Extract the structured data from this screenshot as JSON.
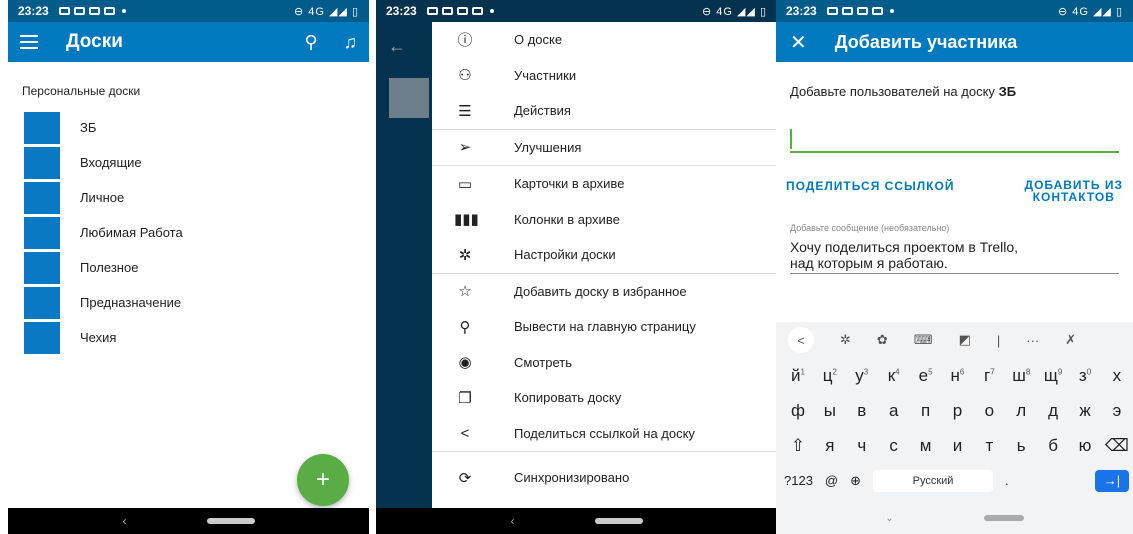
{
  "screen1": {
    "status": {
      "time": "23:23",
      "sys": "⊖ 4G ◢◢ ▯"
    },
    "appbar": {
      "title": "Доски"
    },
    "section": "Персональные доски",
    "boards": [
      "ЗБ",
      "Входящие",
      "Личное",
      "Любимая Работа",
      "Полезное",
      "Предназначение",
      "Чехия"
    ],
    "fab": "+",
    "nav": {
      "back": "‹"
    }
  },
  "screen2": {
    "status": {
      "time": "23:23",
      "sys": "⊖ 4G ◢◢ ▯"
    },
    "back": "←",
    "groups": [
      [
        {
          "icon": "ⓘ",
          "label": "О доске",
          "name": "about-board"
        },
        {
          "icon": "⚇",
          "label": "Участники",
          "name": "members"
        },
        {
          "icon": "☰",
          "label": "Действия",
          "name": "actions"
        }
      ],
      [
        {
          "icon": "➢",
          "label": "Улучшения",
          "name": "power-ups"
        }
      ],
      [
        {
          "icon": "▭",
          "label": "Карточки в архиве",
          "name": "archived-cards"
        },
        {
          "icon": "▮▮▮",
          "label": "Колонки в архиве",
          "name": "archived-lists"
        },
        {
          "icon": "✲",
          "label": "Настройки доски",
          "name": "board-settings"
        }
      ],
      [
        {
          "icon": "☆",
          "label": "Добавить доску в избранное",
          "name": "add-favorite"
        },
        {
          "icon": "⚲",
          "label": "Вывести на главную страницу",
          "name": "pin-home"
        },
        {
          "icon": "◉",
          "label": "Смотреть",
          "name": "watch"
        },
        {
          "icon": "❐",
          "label": "Копировать доску",
          "name": "copy-board"
        },
        {
          "icon": "<",
          "label": "Поделиться ссылкой на доску",
          "name": "share-link"
        }
      ],
      [
        {
          "icon": "⟳",
          "label": "Синхронизировано",
          "name": "synced"
        }
      ]
    ],
    "nav": {
      "back": "‹"
    }
  },
  "screen3": {
    "status": {
      "time": "23:23",
      "sys": "⊖ 4G ◢◢ ▯"
    },
    "appbar": {
      "close": "✕",
      "title": "Добавить участника"
    },
    "add_text": "Добавьте пользователей на доску",
    "board_name": "ЗБ",
    "field_value": "",
    "share_link": "ПОДЕЛИТЬСЯ ССЫЛКОЙ",
    "add_contacts_1": "ДОБАВИТЬ ИЗ",
    "add_contacts_2": "КОНТАКТОВ",
    "hint": "Добавьте сообщение (необязательно)",
    "message_1": "Хочу поделиться проектом в Trello,",
    "message_2": "над которым я работаю.",
    "keyboard": {
      "tools": [
        "<",
        "✲",
        "✿",
        "⌨",
        "◩",
        "|",
        "···",
        "✗"
      ],
      "row1": [
        [
          "й",
          "1"
        ],
        [
          "ц",
          "2"
        ],
        [
          "у",
          "3"
        ],
        [
          "к",
          "4"
        ],
        [
          "е",
          "5"
        ],
        [
          "н",
          "6"
        ],
        [
          "г",
          "7"
        ],
        [
          "ш",
          "8"
        ],
        [
          "щ",
          "9"
        ],
        [
          "з",
          "0"
        ],
        [
          "х",
          ""
        ]
      ],
      "row2": [
        "ф",
        "ы",
        "в",
        "а",
        "п",
        "р",
        "о",
        "л",
        "д",
        "ж",
        "э"
      ],
      "row3": [
        "⇧",
        "я",
        "ч",
        "с",
        "м",
        "и",
        "т",
        "ь",
        "б",
        "ю",
        "⌫"
      ],
      "sym": "?123",
      "at": "@",
      "globe": "⊕",
      "lang": "Русский",
      "dot": ".",
      "enter": "→|"
    },
    "nav": {
      "down": "⌄"
    }
  }
}
